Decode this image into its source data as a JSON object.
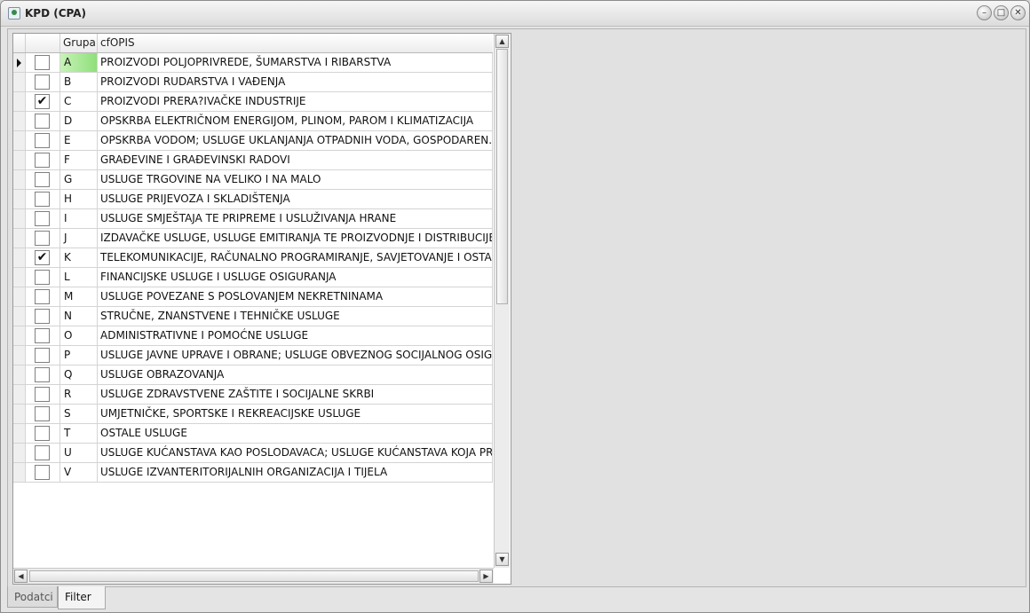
{
  "window": {
    "title": "KPD (CPA)"
  },
  "grid": {
    "columns": [
      "Grupa",
      "cfOPIS"
    ],
    "rows": [
      {
        "grupa": "A",
        "opis": "PROIZVODI POLJOPRIVREDE, ŠUMARSTVA I RIBARSTVA",
        "checked": false,
        "current": true
      },
      {
        "grupa": "B",
        "opis": "PROIZVODI RUDARSTVA I VAĐENJA",
        "checked": false
      },
      {
        "grupa": "C",
        "opis": "PROIZVODI PRERA?IVAČKE INDUSTRIJE",
        "checked": true
      },
      {
        "grupa": "D",
        "opis": "OPSKRBA ELEKTRIČNOM ENERGIJOM, PLINOM, PAROM I KLIMATIZACIJA",
        "checked": false
      },
      {
        "grupa": "E",
        "opis": "OPSKRBA VODOM; USLUGE UKLANJANJA OTPADNIH VODA, GOSPODAREN...",
        "checked": false
      },
      {
        "grupa": "F",
        "opis": "GRAĐEVINE I GRAĐEVINSKI RADOVI",
        "checked": false
      },
      {
        "grupa": "G",
        "opis": "USLUGE TRGOVINE NA VELIKO I NA MALO",
        "checked": false
      },
      {
        "grupa": "H",
        "opis": "USLUGE PRIJEVOZA I SKLADIŠTENJA",
        "checked": false
      },
      {
        "grupa": "I",
        "opis": "USLUGE SMJEŠTAJA TE PRIPREME I USLUŽIVANJA HRANE",
        "checked": false
      },
      {
        "grupa": "J",
        "opis": "IZDAVAČKE USLUGE, USLUGE EMITIRANJA TE PROIZVODNJE I DISTRIBUCIJE",
        "checked": false
      },
      {
        "grupa": "K",
        "opis": "TELEKOMUNIKACIJE, RAČUNALNO PROGRAMIRANJE, SAVJETOVANJE I OSTA",
        "checked": true
      },
      {
        "grupa": "L",
        "opis": "FINANCIJSKE USLUGE I USLUGE OSIGURANJA",
        "checked": false
      },
      {
        "grupa": "M",
        "opis": "USLUGE POVEZANE S POSLOVANJEM NEKRETNINAMA",
        "checked": false
      },
      {
        "grupa": "N",
        "opis": "STRUČNE, ZNANSTVENE I TEHNIČKE USLUGE",
        "checked": false
      },
      {
        "grupa": "O",
        "opis": "ADMINISTRATIVNE I POMOĆNE USLUGE",
        "checked": false
      },
      {
        "grupa": "P",
        "opis": "USLUGE JAVNE UPRAVE I OBRANE; USLUGE OBVEZNOG SOCIJALNOG OSIGU",
        "checked": false
      },
      {
        "grupa": "Q",
        "opis": "USLUGE OBRAZOVANJA",
        "checked": false
      },
      {
        "grupa": "R",
        "opis": "USLUGE ZDRAVSTVENE ZAŠTITE I SOCIJALNE SKRBI",
        "checked": false
      },
      {
        "grupa": "S",
        "opis": "UMJETNIČKE, SPORTSKE I REKREACIJSKE USLUGE",
        "checked": false
      },
      {
        "grupa": "T",
        "opis": "OSTALE USLUGE",
        "checked": false
      },
      {
        "grupa": "U",
        "opis": "USLUGE KUĆANSTAVA KAO POSLODAVACA; USLUGE KUĆANSTAVA KOJA PR",
        "checked": false
      },
      {
        "grupa": "V",
        "opis": "USLUGE IZVANTERITORIJALNIH ORGANIZACIJA I TIJELA",
        "checked": false
      }
    ]
  },
  "tabs": [
    {
      "label": "Podatci",
      "active": false
    },
    {
      "label": "Filter",
      "active": true
    }
  ],
  "colors": {
    "current_cell": "#8fe07a"
  },
  "icons": [
    "app-icon",
    "minimize-icon",
    "maximize-icon",
    "close-icon",
    "row-indicator-icon",
    "checkmark-icon",
    "scroll-up-icon",
    "scroll-down-icon",
    "scroll-left-icon",
    "scroll-right-icon"
  ]
}
